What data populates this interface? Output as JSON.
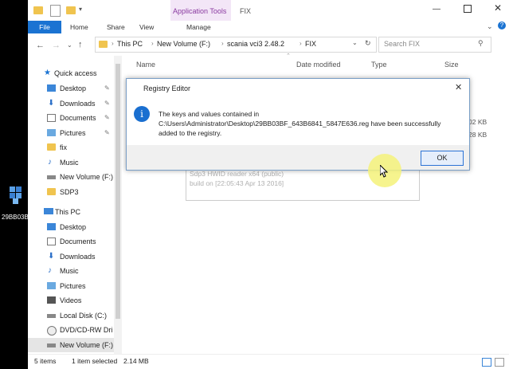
{
  "desktop": {
    "icon_label": "29BB03B"
  },
  "titlebar": {
    "app_tools": "Application Tools",
    "folder_title": "FIX"
  },
  "ribbon": {
    "file": "File",
    "home": "Home",
    "share": "Share",
    "view": "View",
    "manage": "Manage"
  },
  "address": {
    "path": [
      "This PC",
      "New Volume (F:)",
      "scania vci3 2.48.2",
      "FIX"
    ],
    "search_placeholder": "Search FIX"
  },
  "columns": {
    "name": "Name",
    "date": "Date modified",
    "type": "Type",
    "size": "Size"
  },
  "behind_sizes": [
    "02 KB",
    "28 KB"
  ],
  "nav": {
    "quick_access": "Quick access",
    "quick_items": [
      "Desktop",
      "Downloads",
      "Documents",
      "Pictures",
      "fix",
      "Music",
      "New Volume (F:)",
      "SDP3"
    ],
    "this_pc": "This PC",
    "pc_items": [
      "Desktop",
      "Documents",
      "Downloads",
      "Music",
      "Pictures",
      "Videos",
      "Local Disk (C:)",
      "DVD/CD-RW Dri",
      "New Volume (F:)"
    ]
  },
  "tooltip": {
    "line1": "Sdp3 HWID reader x64 (public)",
    "line2": "build on [22:05:43 Apr 13 2016]"
  },
  "dialog": {
    "title": "Registry Editor",
    "message_line1": "The keys and values contained in",
    "message_line2": "C:\\Users\\Administrator\\Desktop\\29BB03BF_643B6841_5847E636.reg have been successfully",
    "message_line3": "added to the registry.",
    "ok": "OK"
  },
  "status": {
    "items": "5 items",
    "selected": "1 item selected",
    "size": "2.14 MB"
  },
  "colors": {
    "accent": "#1a73d2",
    "dialog_border": "#7a9fc7",
    "folder": "#f0c44f"
  }
}
